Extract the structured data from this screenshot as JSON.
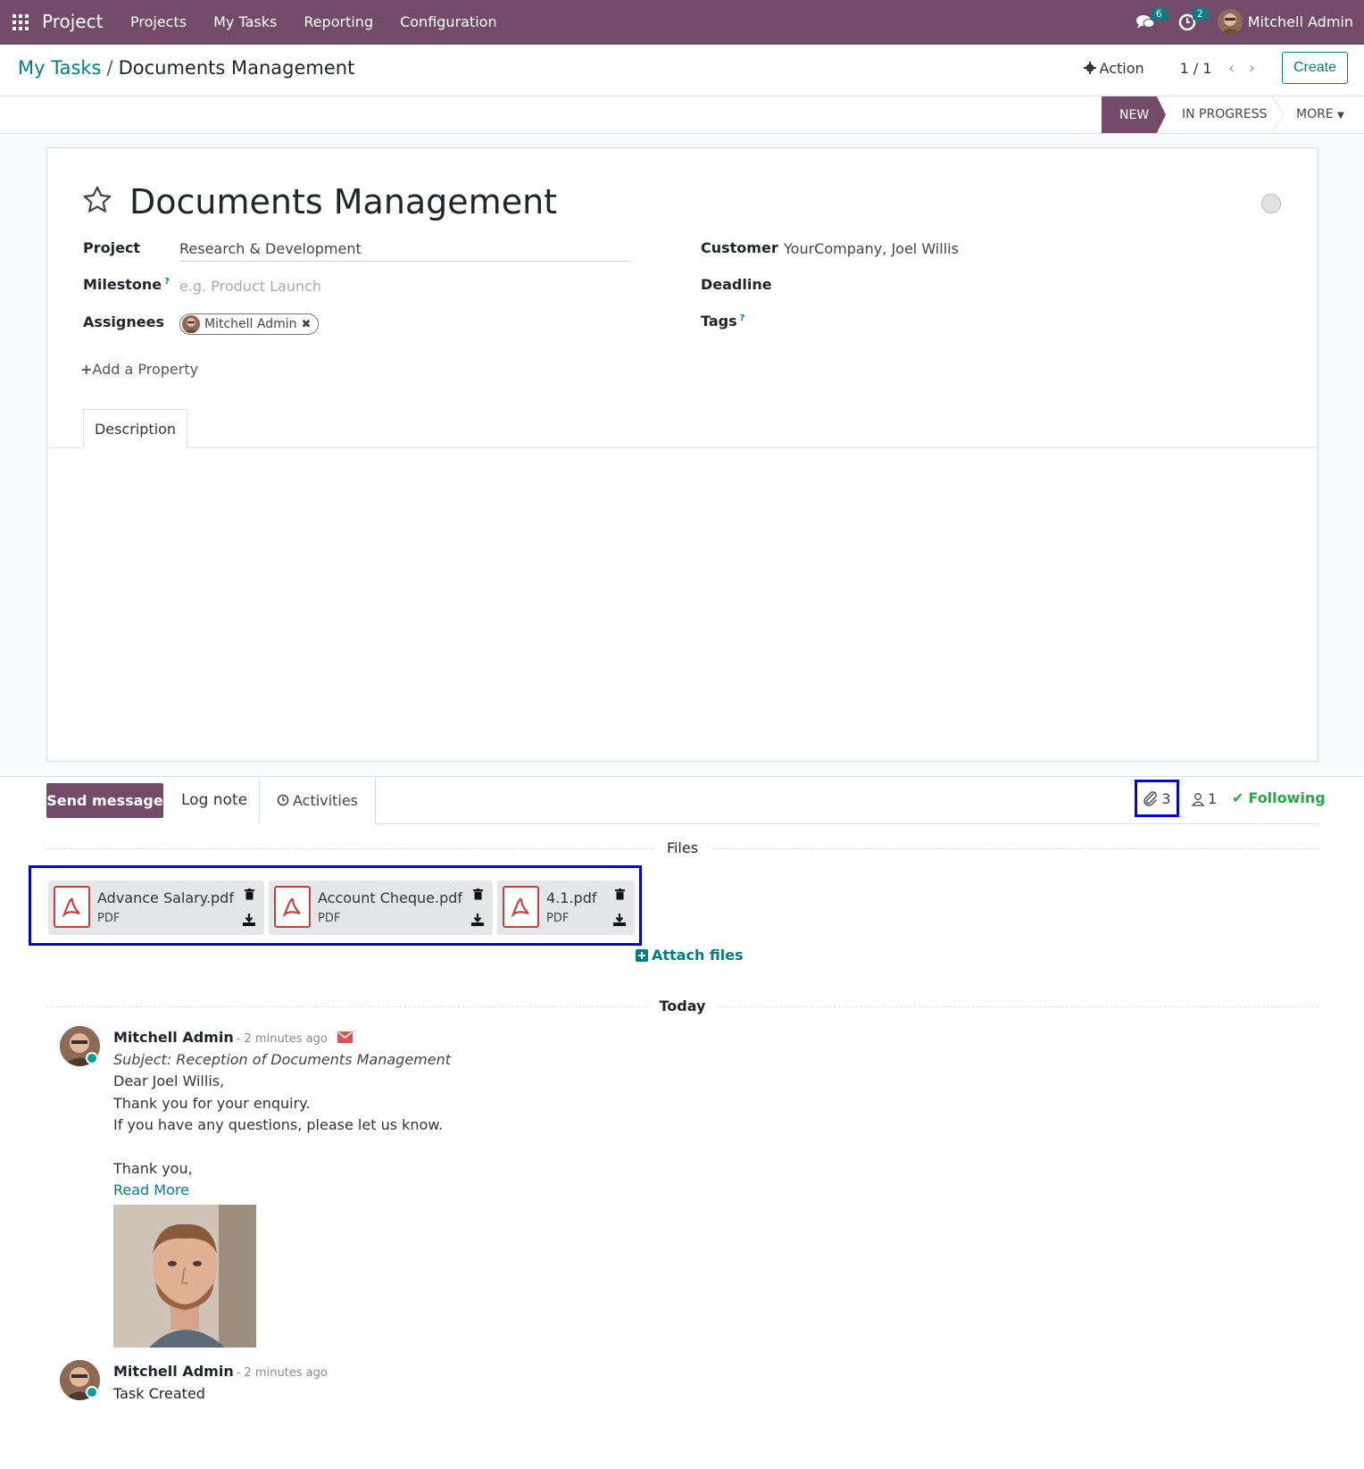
{
  "navbar": {
    "app_name": "Project",
    "menu": [
      "Projects",
      "My Tasks",
      "Reporting",
      "Configuration"
    ],
    "messages_badge": "6",
    "activities_badge": "2",
    "user_name": "Mitchell Admin",
    "bg_color": "#714b67"
  },
  "control_panel": {
    "breadcrumb_parent": "My Tasks",
    "breadcrumb_sep": "/",
    "breadcrumb_current": "Documents Management",
    "action_label": "Action",
    "pager": "1 / 1",
    "create_label": "Create"
  },
  "statusbar": {
    "stages": [
      "NEW",
      "IN PROGRESS"
    ],
    "active_stage": "NEW",
    "more_label": "MORE"
  },
  "form": {
    "title": "Documents Management",
    "project_label": "Project",
    "project_value": "Research & Development",
    "milestone_label": "Milestone",
    "milestone_help": "?",
    "milestone_placeholder": "e.g. Product Launch",
    "assignees_label": "Assignees",
    "assignee_tag": "Mitchell Admin",
    "customer_label": "Customer",
    "customer_value": "YourCompany, Joel Willis",
    "deadline_label": "Deadline",
    "tags_label": "Tags",
    "tags_help": "?",
    "add_property": "Add a Property",
    "tab_description": "Description"
  },
  "chatter": {
    "send_message": "Send message",
    "log_note": "Log note",
    "activities": "Activities",
    "attachment_count": "3",
    "follower_count": "1",
    "following": "Following",
    "files_separator": "Files",
    "files": [
      {
        "name": "Advance Salary.pdf",
        "type": "PDF"
      },
      {
        "name": "Account Cheque.pdf",
        "type": "PDF"
      },
      {
        "name": "4.1.pdf",
        "type": "PDF"
      }
    ],
    "attach_files": "Attach files",
    "today_separator": "Today",
    "messages": [
      {
        "author": "Mitchell Admin",
        "date": "- 2 minutes ago",
        "subject": "Subject: Reception of Documents Management",
        "lines": [
          "Dear Joel Willis,",
          "Thank you for your enquiry.",
          "If you have any questions, please let us know.",
          "Thank you,"
        ],
        "read_more": "Read More"
      },
      {
        "author": "Mitchell Admin",
        "date": "- 2 minutes ago",
        "body": "Task Created"
      }
    ]
  }
}
